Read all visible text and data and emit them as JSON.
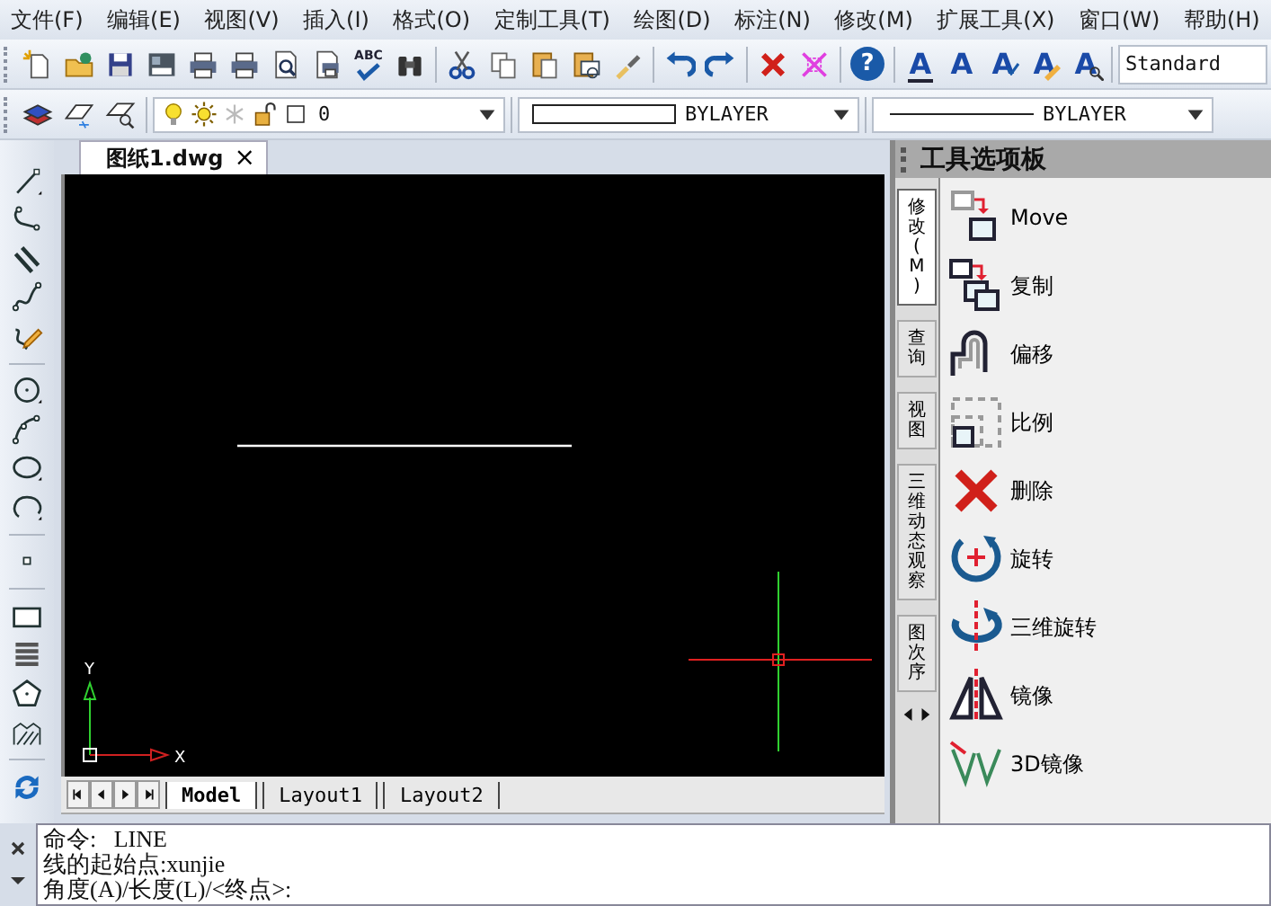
{
  "menu": [
    {
      "label": "文件(F)"
    },
    {
      "label": "编辑(E)"
    },
    {
      "label": "视图(V)"
    },
    {
      "label": "插入(I)"
    },
    {
      "label": "格式(O)"
    },
    {
      "label": "定制工具(T)"
    },
    {
      "label": "绘图(D)"
    },
    {
      "label": "标注(N)"
    },
    {
      "label": "修改(M)"
    },
    {
      "label": "扩展工具(X)"
    },
    {
      "label": "窗口(W)"
    },
    {
      "label": "帮助(H)"
    }
  ],
  "toolbar": {
    "spell_check_label": "ABC",
    "help_label": "?",
    "text_style_buttons": [
      "A",
      "A",
      "A",
      "A",
      "A"
    ],
    "text_style": "Standard"
  },
  "properties_bar": {
    "layer": "0",
    "color_setting": "BYLAYER",
    "linetype": "BYLAYER"
  },
  "document_tab": {
    "title": "图纸1.dwg",
    "close": "×"
  },
  "ucs": {
    "x_label": "X",
    "y_label": "Y"
  },
  "layout_tabs": [
    {
      "label": "Model",
      "selected": true
    },
    {
      "label": "Layout1",
      "selected": false
    },
    {
      "label": "Layout2",
      "selected": false
    }
  ],
  "tool_palette": {
    "title": "工具选项板",
    "tabs": [
      {
        "label": "修改(M)",
        "selected": true
      },
      {
        "label": "查询",
        "selected": false
      },
      {
        "label": "视图",
        "selected": false
      },
      {
        "label": "三维动态观察",
        "selected": false
      },
      {
        "label": "图次序",
        "selected": false
      }
    ],
    "items": [
      {
        "kind": "move",
        "label": "Move"
      },
      {
        "kind": "copy",
        "label": "复制"
      },
      {
        "kind": "offset",
        "label": "偏移"
      },
      {
        "kind": "scale",
        "label": "比例"
      },
      {
        "kind": "erase",
        "label": "删除"
      },
      {
        "kind": "rotate",
        "label": "旋转"
      },
      {
        "kind": "rotate3d",
        "label": "三维旋转"
      },
      {
        "kind": "mirror",
        "label": "镜像"
      },
      {
        "kind": "mirror3d",
        "label": "3D镜像"
      }
    ]
  },
  "command_line": {
    "lines": [
      "命令:   LINE",
      "线的起始点:xunjie",
      "角度(A)/长度(L)/<终点>:"
    ]
  }
}
